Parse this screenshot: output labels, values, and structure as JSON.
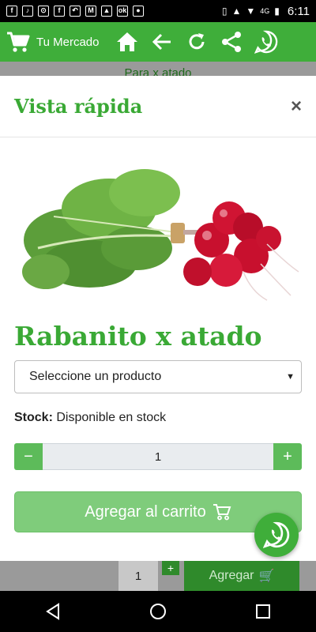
{
  "status_bar": {
    "time": "6:11",
    "network": "4G"
  },
  "header": {
    "brand": "Tu Mercado"
  },
  "background": {
    "strip_text": "Para x atado",
    "qty_value": "1",
    "add_label": "Agregar"
  },
  "modal": {
    "title": "Vista rápida",
    "close_label": "×",
    "product_title": "Rabanito x atado",
    "select": {
      "selected": "Seleccione un producto"
    },
    "stock": {
      "label": "Stock:",
      "value": "Disponible en stock"
    },
    "quantity": {
      "minus": "−",
      "value": "1",
      "plus": "+"
    },
    "add_button_label": "Agregar al carrito"
  },
  "colors": {
    "brand_green": "#3fae3a",
    "title_green": "#3aa935",
    "button_green": "#7fcc7b"
  },
  "icons": [
    "cart-icon",
    "home-icon",
    "back-arrow-icon",
    "refresh-icon",
    "share-icon",
    "whatsapp-icon",
    "close-icon",
    "nav-back-icon",
    "nav-home-icon",
    "nav-recents-icon"
  ]
}
